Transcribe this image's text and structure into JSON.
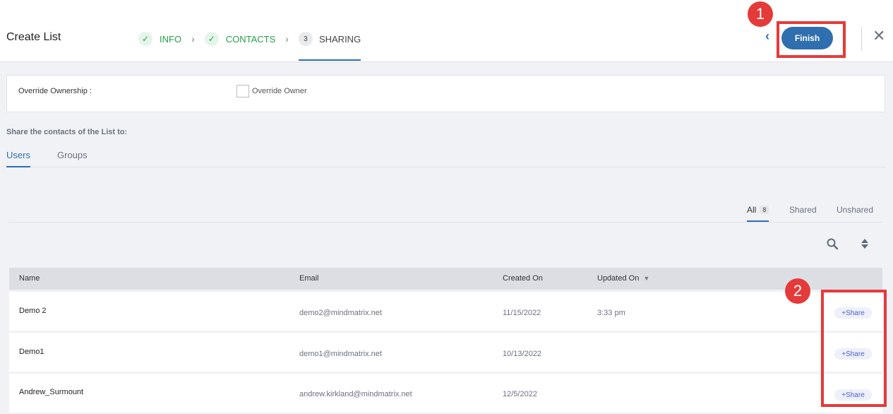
{
  "header": {
    "title": "Create List",
    "steps": [
      {
        "label": "INFO",
        "state": "done",
        "icon": "check-icon"
      },
      {
        "label": "CONTACTS",
        "state": "done",
        "icon": "check-icon"
      },
      {
        "label": "SHARING",
        "state": "current",
        "number": "3"
      }
    ],
    "finish_label": "Finish"
  },
  "annotations": {
    "one": "1",
    "two": "2",
    "color": "#e53a3a"
  },
  "override": {
    "label": "Override Ownership :",
    "checkbox_label": "Override Owner",
    "checked": false
  },
  "share_heading": "Share the contacts of the List to:",
  "tabs": {
    "users": "Users",
    "groups": "Groups"
  },
  "filters": {
    "all": "All",
    "all_count": "8",
    "shared": "Shared",
    "unshared": "Unshared"
  },
  "table": {
    "columns": {
      "name": "Name",
      "email": "Email",
      "created": "Created On",
      "updated": "Updated On"
    },
    "share_label": "Share",
    "rows": [
      {
        "name": "Demo 2",
        "email": "demo2@mindmatrix.net",
        "created": "11/15/2022",
        "updated": "3:33 pm"
      },
      {
        "name": "Demo1",
        "email": "demo1@mindmatrix.net",
        "created": "10/13/2022",
        "updated": ""
      },
      {
        "name": "Andrew_Surmount",
        "email": "andrew.kirkland@mindmatrix.net",
        "created": "12/5/2022",
        "updated": ""
      }
    ]
  },
  "colors": {
    "accent": "#2f6fb0",
    "success": "#24a148",
    "annotation": "#e53a3a"
  }
}
